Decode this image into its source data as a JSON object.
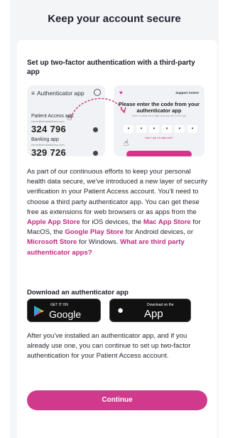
{
  "page": {
    "title": "Keep your account secure"
  },
  "card": {
    "heading": "Set up two-factor authentication with a third-party app",
    "illustration": {
      "left": {
        "app_title": "Authenticator app",
        "accounts": [
          {
            "name": "Patient Access app",
            "email": "name@emailaddress.com",
            "code": "324 796"
          },
          {
            "name": "Banking app",
            "email": "name@emailaddress.com",
            "code": "329 726"
          }
        ]
      },
      "right": {
        "support": "Support Centre",
        "prompt": "Please enter the code from your authenticator app",
        "paste_hint": "Enter or paste the 6-digit code you see in the app",
        "digit_placeholder": "•",
        "help_link": "Have I got a 6-digit code?"
      }
    },
    "body": {
      "p1": "As part of our continuous efforts to keep your personal health data secure, we've introduced a new layer of security verification in your Patient Access account. You'll need to choose a third party authenticator app. You can get these free as extensions for web browsers or as apps from the ",
      "link_apple": "Apple App Store",
      "t2": " for iOS devices, the ",
      "link_mac": "Mac App Store",
      "t3": " for MacOS, the ",
      "link_google": "Google Play Store",
      "t4": " for Android devices, or ",
      "link_microsoft": "Microsoft Store",
      "t5": " for Windows. ",
      "link_what": "What are third party authenticator apps?"
    },
    "download": {
      "label": "Download an authenticator app",
      "google_small": "GET IT ON",
      "google_big": "Google Play",
      "apple_small": "Download on the",
      "apple_big": "App Store"
    },
    "after": "After you've installed an authenticator app, and if you already use one, you can continue to set up two-factor authentication for your Patient Access account.",
    "continue_label": "Continue"
  },
  "colors": {
    "accent": "#d13a8c",
    "link": "#c3277d",
    "panel": "#f4f5f7"
  }
}
